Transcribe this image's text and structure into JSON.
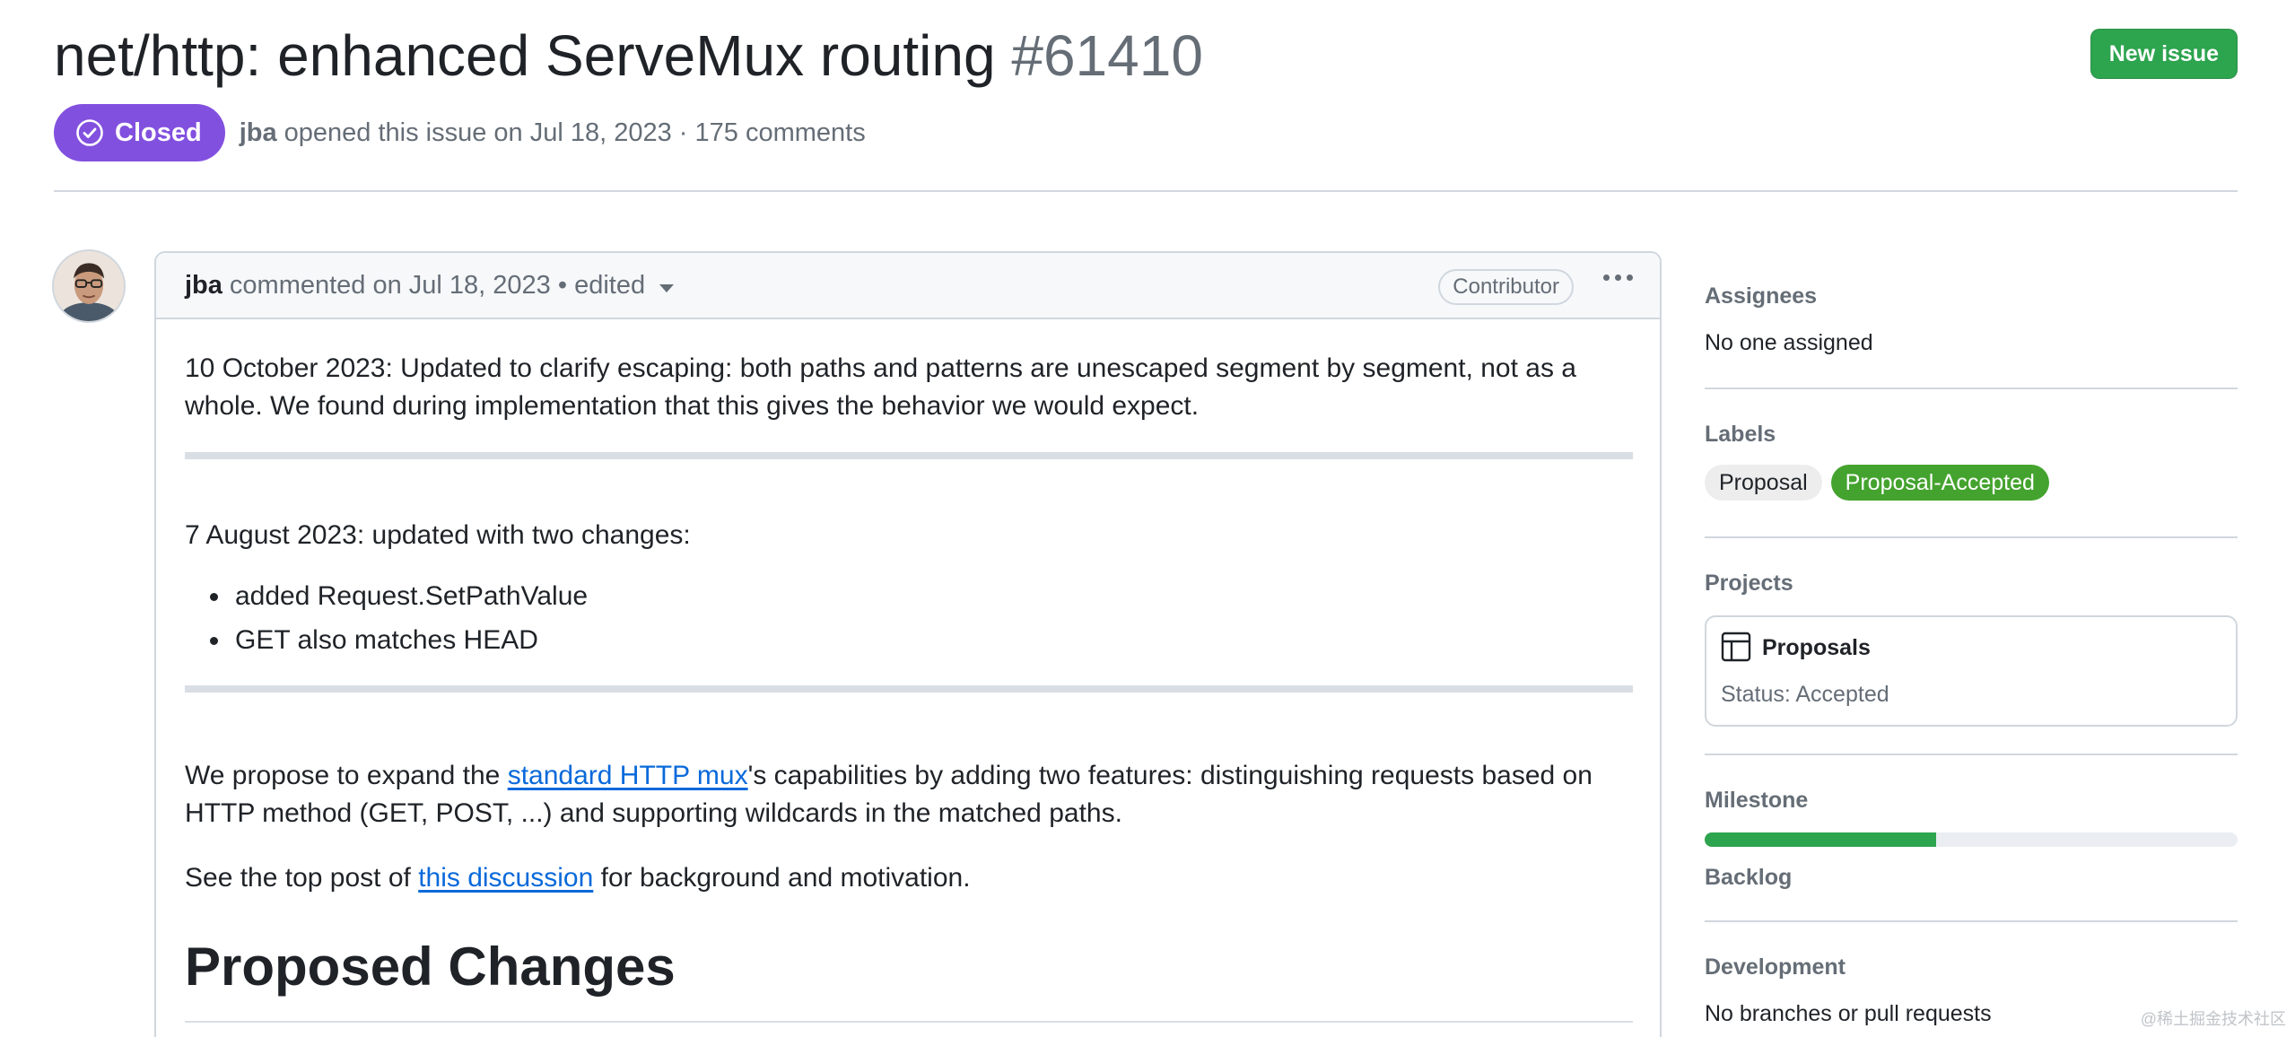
{
  "issue": {
    "title": "net/http: enhanced ServeMux routing",
    "number": "#61410",
    "new_issue_label": "New issue",
    "state": "Closed",
    "author": "jba",
    "opened_text": "opened this issue on Jul 18, 2023 · 175 comments"
  },
  "comment": {
    "author": "jba",
    "meta": "commented on Jul 18, 2023 • edited",
    "role_badge": "Contributor",
    "p1": "10 October 2023: Updated to clarify escaping: both paths and patterns are unescaped segment by segment, not as a whole. We found during implementation that this gives the behavior we would expect.",
    "p2": "7 August 2023: updated with two changes:",
    "bullets": [
      "added Request.SetPathValue",
      "GET also matches HEAD"
    ],
    "p3_before": "We propose to expand the ",
    "p3_link": "standard HTTP mux",
    "p3_after": "'s capabilities by adding two features: distinguishing requests based on HTTP method (GET, POST, ...) and supporting wildcards in the matched paths.",
    "p4_before": "See the top post of ",
    "p4_link": "this discussion",
    "p4_after": " for background and motivation.",
    "heading": "Proposed Changes"
  },
  "sidebar": {
    "assignees": {
      "heading": "Assignees",
      "value": "No one assigned"
    },
    "labels": {
      "heading": "Labels",
      "items": [
        {
          "name": "Proposal",
          "bg": "#ededed",
          "fg": "#1f2328"
        },
        {
          "name": "Proposal-Accepted",
          "bg": "#44a32e",
          "fg": "#ffffff"
        }
      ]
    },
    "projects": {
      "heading": "Projects",
      "name": "Proposals",
      "status": "Status: Accepted"
    },
    "milestone": {
      "heading": "Milestone",
      "progress": 0.435,
      "name": "Backlog"
    },
    "development": {
      "heading": "Development",
      "value": "No branches or pull requests"
    }
  },
  "colors": {
    "accent_green": "#2da44e",
    "closed_purple": "#8250df",
    "link_blue": "#0969da"
  },
  "watermark": "@稀土掘金技术社区"
}
